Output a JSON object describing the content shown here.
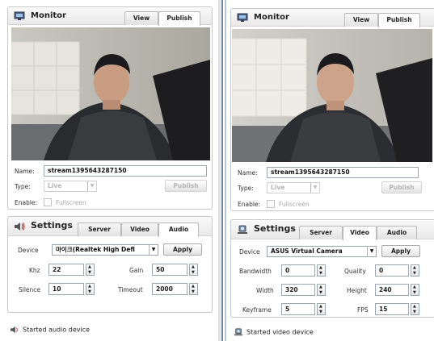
{
  "left": {
    "monitor": {
      "title": "Monitor",
      "tabs": [
        "View",
        "Publish"
      ],
      "name_label": "Name:",
      "name_value": "stream1395643287150",
      "type_label": "Type:",
      "type_value": "Live",
      "publish_label": "Publish",
      "enable_label": "Enable:",
      "fullscreen_label": "Fullscreen"
    },
    "settings": {
      "title": "Settings",
      "tabs": [
        "Server",
        "Video",
        "Audio"
      ],
      "active_tab": "Audio",
      "device_label": "Device",
      "device_value": "마이크(Realtek High Defi",
      "apply_label": "Apply",
      "khz_label": "Khz",
      "khz_value": "22",
      "gain_label": "Gain",
      "gain_value": "50",
      "silence_label": "Silence",
      "silence_value": "10",
      "timeout_label": "Timeout",
      "timeout_value": "2000"
    },
    "status": "Started audio device"
  },
  "right": {
    "monitor": {
      "title": "Monitor",
      "tabs": [
        "View",
        "Publish"
      ],
      "name_label": "Name:",
      "name_value": "stream1395643287150",
      "type_label": "Type:",
      "type_value": "Live",
      "publish_label": "Publish",
      "enable_label": "Enable:",
      "fullscreen_label": "Fullscreen"
    },
    "settings": {
      "title": "Settings",
      "tabs": [
        "Server",
        "Video",
        "Audio"
      ],
      "active_tab": "Video",
      "device_label": "Device",
      "device_value": "ASUS Virtual Camera",
      "apply_label": "Apply",
      "bandwidth_label": "Bandwidth",
      "bandwidth_value": "0",
      "quality_label": "Quality",
      "quality_value": "0",
      "width_label": "Width",
      "width_value": "320",
      "height_label": "Height",
      "height_value": "240",
      "keyframe_label": "Keyframe",
      "keyframe_value": "5",
      "fps_label": "FPS",
      "fps_value": "15"
    },
    "status": "Started video device"
  },
  "icons": {
    "monitor": "monitor-icon",
    "speaker": "speaker-icon",
    "webcam": "webcam-icon"
  },
  "colors": {
    "separator": "#6f87a6",
    "panel_border": "#c7c7c7"
  }
}
